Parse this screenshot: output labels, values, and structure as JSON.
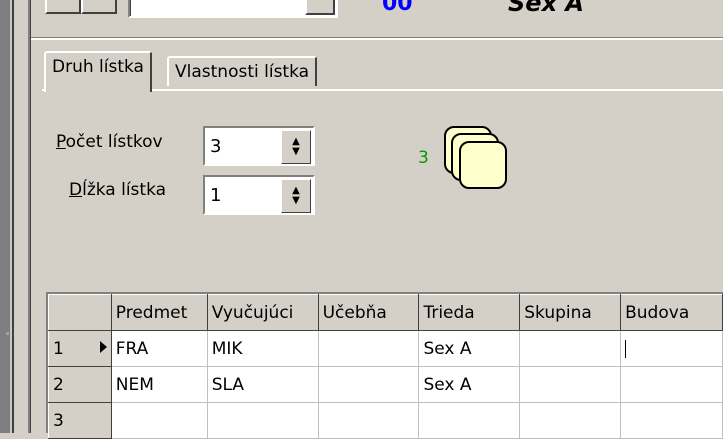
{
  "top": {
    "counter_text": "00",
    "label_text": "Sex A"
  },
  "tabs": [
    {
      "label": "Druh lístka",
      "active": true
    },
    {
      "label": "Vlastnosti lístka",
      "active": false
    }
  ],
  "form": {
    "count_label_access": "P",
    "count_label_rest": "očet lístkov",
    "count_value": "3",
    "length_label_access": "D",
    "length_label_rest": "ĺžka lístka",
    "length_value": "1"
  },
  "cards": {
    "count": "3",
    "fill_color": "#ffffcc"
  },
  "grid": {
    "columns": [
      "Predmet",
      "Vyučujúci",
      "Učebňa",
      "Trieda",
      "Skupina",
      "Budova"
    ],
    "rows": [
      {
        "num": "1",
        "current": true,
        "cells": [
          "FRA",
          "MIK",
          "",
          "Sex A",
          "",
          ""
        ]
      },
      {
        "num": "2",
        "current": false,
        "cells": [
          "NEM",
          "SLA",
          "",
          "Sex A",
          "",
          ""
        ]
      },
      {
        "num": "3",
        "current": false,
        "cells": [
          "",
          "",
          "",
          "",
          "",
          ""
        ]
      }
    ]
  },
  "colors": {
    "face": "#d4d0c8",
    "counter": "#0000ff",
    "cards_count": "#009900"
  }
}
